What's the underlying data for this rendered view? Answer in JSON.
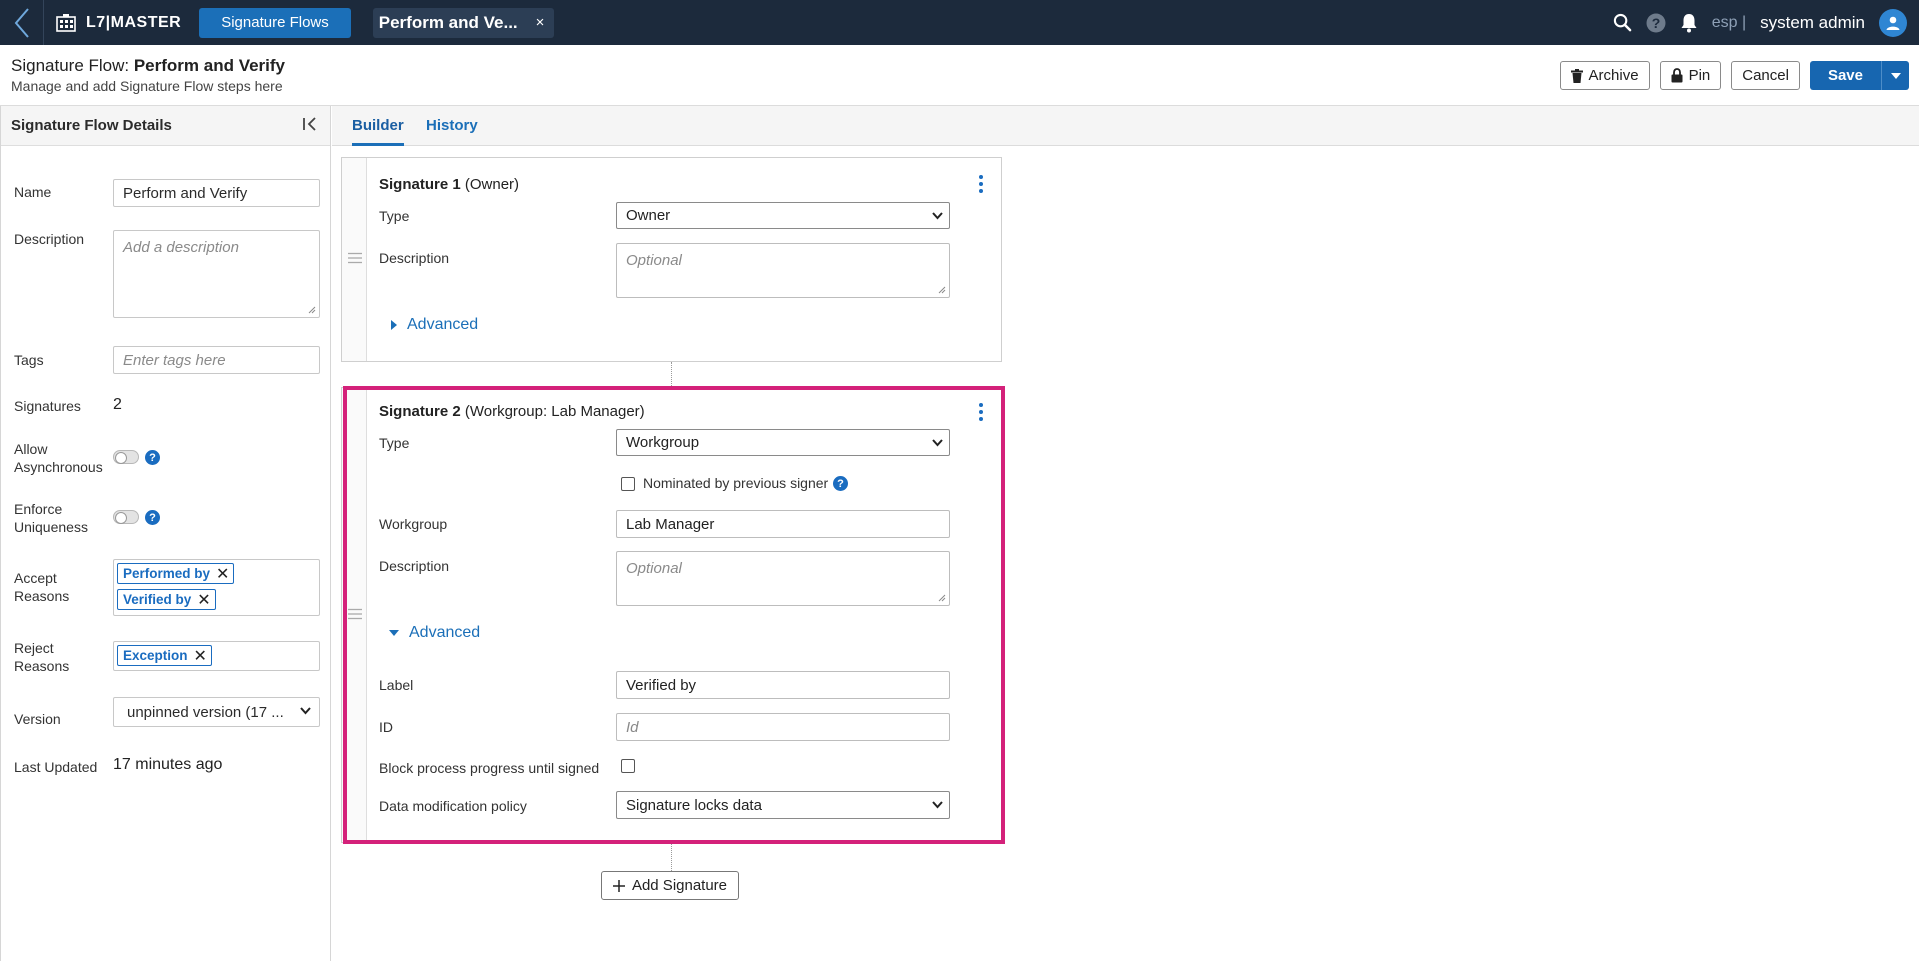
{
  "topbar": {
    "app_name": "L7|MASTER",
    "active_tab": "Signature Flows",
    "doc_tab": "Perform and Ve...",
    "doc_tab_close": "×",
    "language": "esp |",
    "user_name": "system admin"
  },
  "header": {
    "title_prefix": "Signature Flow: ",
    "title_name": "Perform and Verify",
    "subtitle": "Manage and add Signature Flow steps here",
    "archive_label": "Archive",
    "pin_label": "Pin",
    "cancel_label": "Cancel",
    "save_label": "Save"
  },
  "details": {
    "heading": "Signature Flow Details",
    "name_label": "Name",
    "name_value": "Perform and Verify",
    "description_label": "Description",
    "description_placeholder": "Add a description",
    "tags_label": "Tags",
    "tags_placeholder": "Enter tags here",
    "signatures_label": "Signatures",
    "signatures_value": "2",
    "allow_async_label_1": "Allow",
    "allow_async_label_2": "Asynchronous",
    "allow_async_on": false,
    "enforce_label_1": "Enforce",
    "enforce_label_2": "Uniqueness",
    "enforce_on": false,
    "accept_label_1": "Accept",
    "accept_label_2": "Reasons",
    "accept_reasons": [
      "Performed by",
      "Verified by"
    ],
    "reject_label_1": "Reject",
    "reject_label_2": "Reasons",
    "reject_reasons": [
      "Exception"
    ],
    "version_label": "Version",
    "version_value": "unpinned version (17 ...",
    "updated_label": "Last Updated",
    "updated_value": "17 minutes ago"
  },
  "tabs": {
    "builder": "Builder",
    "history": "History"
  },
  "signature1": {
    "title_bold": "Signature 1",
    "title_rest": " (Owner)",
    "type_label": "Type",
    "type_value": "Owner",
    "description_label": "Description",
    "description_placeholder": "Optional",
    "advanced_label": "Advanced",
    "advanced_expanded": false
  },
  "signature2": {
    "title_bold": "Signature 2",
    "title_rest": " (Workgroup: Lab Manager)",
    "type_label": "Type",
    "type_value": "Workgroup",
    "nominated_label": "Nominated by previous signer",
    "nominated_checked": false,
    "workgroup_label": "Workgroup",
    "workgroup_value": "Lab Manager",
    "description_label": "Description",
    "description_placeholder": "Optional",
    "advanced_label": "Advanced",
    "advanced_expanded": true,
    "label_label": "Label",
    "label_value": "Verified by",
    "id_label": "ID",
    "id_placeholder": "Id",
    "block_label": "Block process progress until signed",
    "block_checked": false,
    "policy_label": "Data modification policy",
    "policy_value": "Signature locks data"
  },
  "add_signature_label": "Add Signature",
  "colors": {
    "topbar": "#1c2a3c",
    "accent": "#1b6fb8",
    "highlight": "#d4217a"
  }
}
